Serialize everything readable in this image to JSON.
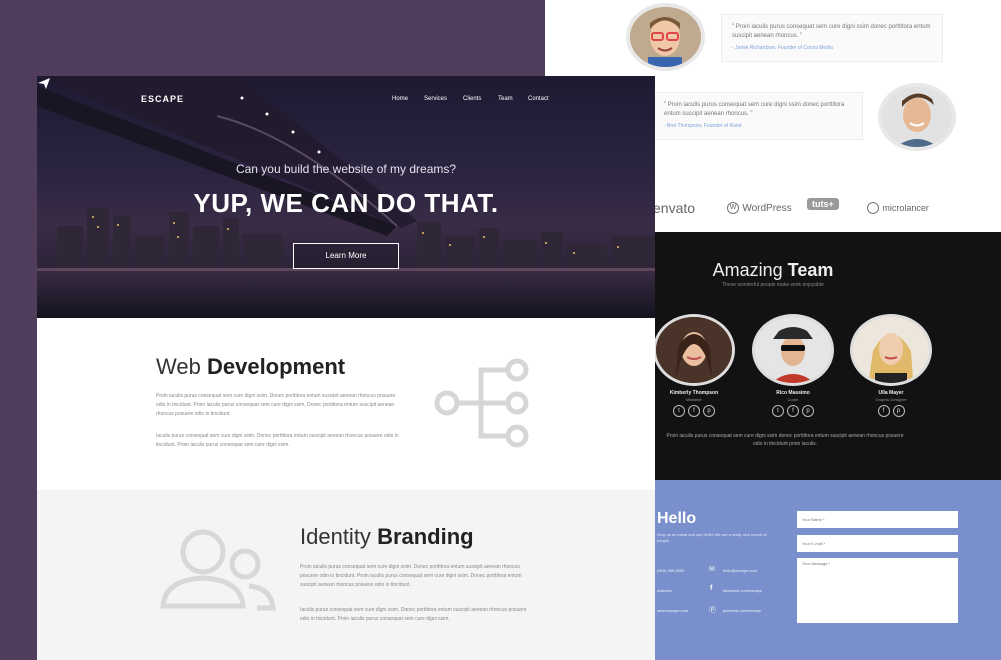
{
  "front": {
    "brand": "ESCAPE",
    "nav": [
      "Home",
      "Services",
      "Clients",
      "Team",
      "Contact"
    ],
    "hero_subtitle": "Can you build the website of my dreams?",
    "hero_title": "YUP, WE CAN DO THAT.",
    "hero_button": "Learn More",
    "web": {
      "title_light": "Web",
      "title_bold": "Development",
      "para1": "Proin iaculis purus consequat sem cure digni ssim. Donec porttitora entum suscipit aenean rhoncus posuere odio in tincidunt. Proin iaculis purus consequat sem cure digni ssim. Donec porttitora entum suscipit aenean rhoncus posuere odio in tincidunt.",
      "para2": "Iaculis purus consequat sem cure digni ssim. Donec porttitora entum suscipit aenean rhoncus posuere odio in tincidunt. Proin iaculis purus consequat sem cure digni ssim.",
      "icon": "sitemap-icon"
    },
    "branding": {
      "title_light": "Identity",
      "title_bold": "Branding",
      "para1": "Proin iaculis purus consequat sem cure digni ssim. Donec porttitora entum suscipit aenean rhoncus posuere odio in tincidunt. Proin iaculis purus consequat sem cure digni ssim. Donec porttitora entum suscipit aenean rhoncus posuere odio in tincidunt.",
      "para2": "Iaculis purus consequat sem cure digni ssim. Donec porttitora entum suscipit aenean rhoncus posuere odio in tincidunt. Proin iaculis purus consequat sem cure digni ssim.",
      "icon": "users-icon"
    }
  },
  "back": {
    "testimonials": [
      {
        "quote": "\" Proin iaculis purus consequat sem cure digni ssim donec porttitora entum suscipit aenean rhoncus. \"",
        "author": "- Jamie Richardson, Founder of Cocoa Media"
      },
      {
        "quote": "\" Proin iaculis purus consequat sem cure digni ssim donec porttitora entum suscipit aenean rhoncus. \"",
        "author": "- Bret Thompson, Founder of Rand"
      }
    ],
    "logos": [
      "envato",
      "WordPress",
      "tuts+",
      "microlancer"
    ],
    "team": {
      "title_light": "Amazing",
      "title_bold": "Team",
      "subtitle": "These wonderful people make work enjoyable",
      "members": [
        {
          "name": "Kimberly Thompson",
          "role": "Marketer"
        },
        {
          "name": "Rico Massimo",
          "role": "Coder"
        },
        {
          "name": "Ulla Mayer",
          "role": "Graphic Designer"
        }
      ],
      "text": "Proin iaculis purus consequat sem cure digni ssim donec porttitora entum suscipit aenean rhoncus posuere odio in tincidunt proin iaculis."
    },
    "contact": {
      "title": "Hello",
      "desc": "Drop us an email and say Hello! We are a really nice bunch of people.",
      "phone": "(555) 555-5555",
      "address": "Address",
      "email": "hello@escape.com",
      "facebook": "facebook.com/escape",
      "web": "www.escape.com",
      "pinterest": "pinterest.com/escape",
      "name_placeholder": "Your Name *",
      "email_placeholder": "Your E-mail *",
      "message_placeholder": "Your Message *"
    }
  }
}
